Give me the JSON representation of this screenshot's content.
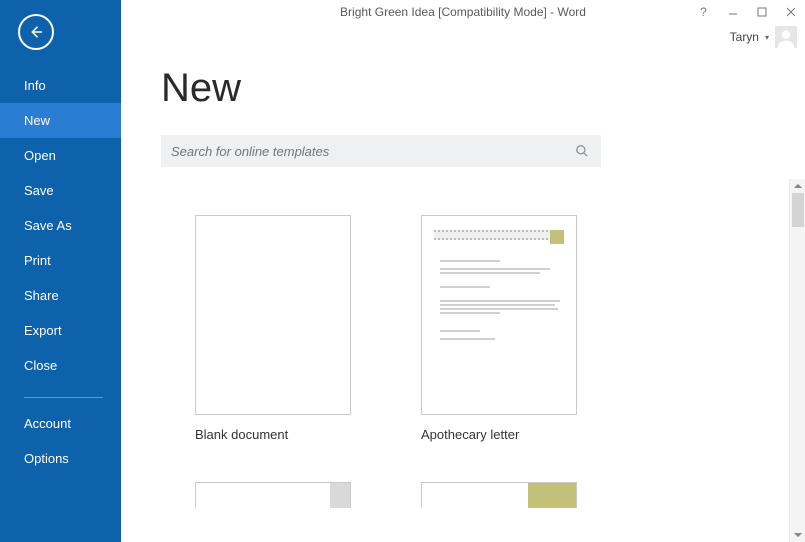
{
  "window": {
    "title": "Bright Green Idea [Compatibility Mode] - Word",
    "user_name": "Taryn"
  },
  "sidebar": {
    "items": [
      {
        "label": "Info"
      },
      {
        "label": "New"
      },
      {
        "label": "Open"
      },
      {
        "label": "Save"
      },
      {
        "label": "Save As"
      },
      {
        "label": "Print"
      },
      {
        "label": "Share"
      },
      {
        "label": "Export"
      },
      {
        "label": "Close"
      }
    ],
    "footer_items": [
      {
        "label": "Account"
      },
      {
        "label": "Options"
      }
    ],
    "active_index": 1
  },
  "page": {
    "title": "New",
    "search_placeholder": "Search for online templates"
  },
  "templates": [
    {
      "label": "Blank document"
    },
    {
      "label": "Apothecary letter"
    }
  ]
}
